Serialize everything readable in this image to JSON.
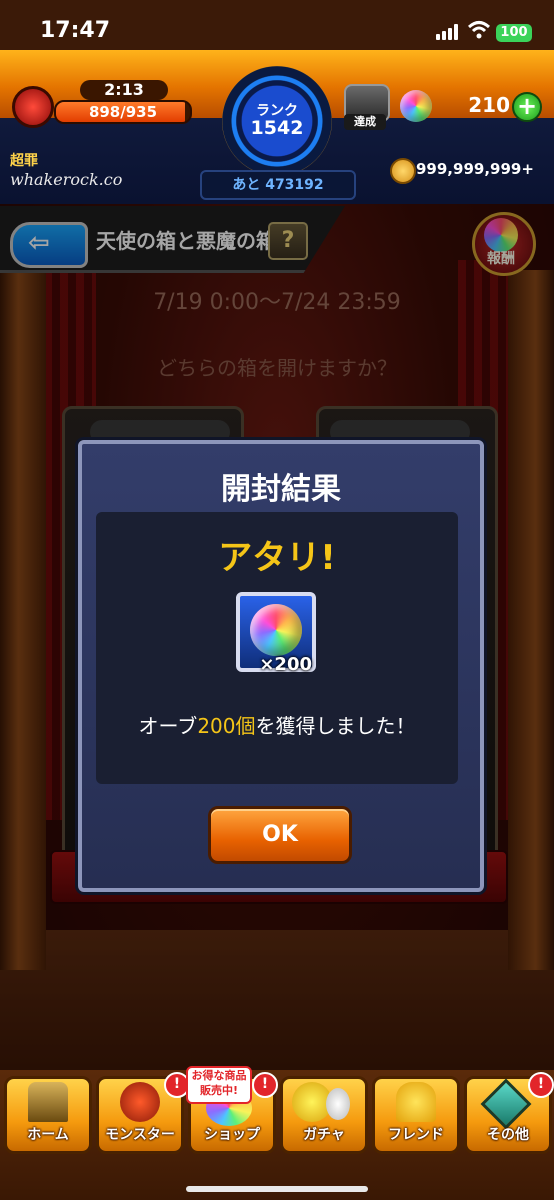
{
  "status_bar": {
    "time": "17:47",
    "battery": "100"
  },
  "header": {
    "stamina_timer": "2:13",
    "stamina": "898/935",
    "stamina_fraction": 0.96,
    "rank_label": "ランク",
    "rank_value": "1542",
    "exp_remaining": "あと 473192",
    "achievement_label": "達成",
    "orb_count": "210",
    "add_orb": "+",
    "title": "超罪",
    "username": "whakerock.co",
    "coins": "999,999,999+"
  },
  "event": {
    "back": "⇦",
    "title": "天使の箱と悪魔の箱",
    "help": "?",
    "reward_label": "報酬",
    "period": "7/19 0:00～7/24 23:59",
    "question": "どちらの箱を開けますか？"
  },
  "modal": {
    "title": "開封結果",
    "result": "アタリ!",
    "item_quantity": "×200",
    "message_before": "オーブ",
    "message_highlight": "200個",
    "message_after": "を獲得しました！",
    "ok_label": "OK"
  },
  "bottom_nav": {
    "items": [
      {
        "label": "ホーム"
      },
      {
        "label": "モンスター"
      },
      {
        "label": "ショップ"
      },
      {
        "label": "ガチャ"
      },
      {
        "label": "フレンド"
      },
      {
        "label": "その他"
      }
    ],
    "shop_badge_line1": "お得な商品",
    "shop_badge_line2": "販売中!",
    "alert": "!"
  },
  "colors": {
    "accent_orange": "#e86200",
    "highlight_yellow": "#f5c518",
    "modal_bg": "#2d365e"
  }
}
